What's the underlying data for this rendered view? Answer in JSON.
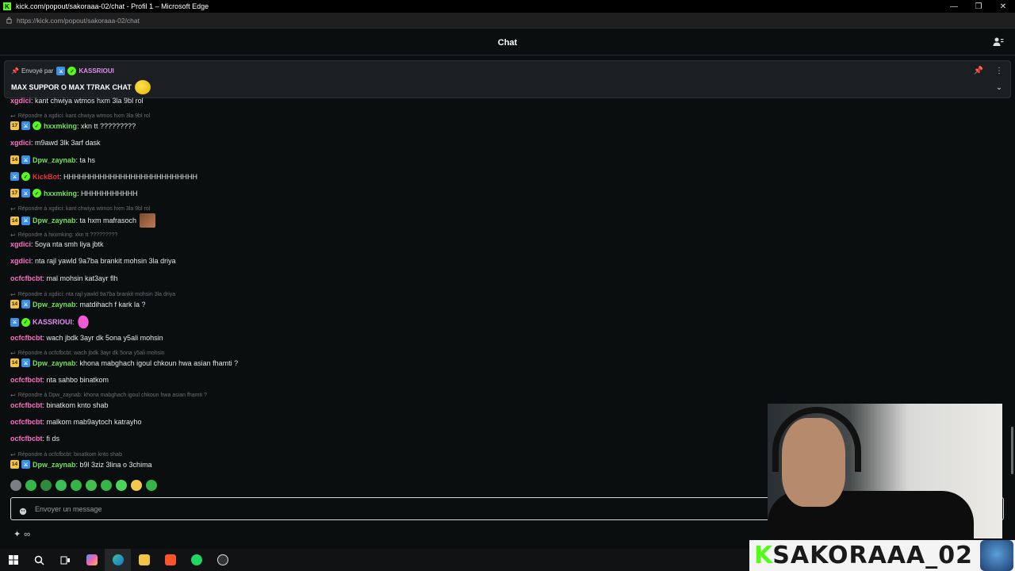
{
  "window": {
    "title": "kick.com/popout/sakoraaa-02/chat - Profil 1 – Microsoft Edge",
    "url": "https://kick.com/popout/sakoraaa-02/chat"
  },
  "header": {
    "title": "Chat"
  },
  "pinned": {
    "sent_by_label": "Envoyé par",
    "author": "KASSRIOUI",
    "message": "MAX SUPPOR O MAX T7RAK CHAT"
  },
  "messages": [
    {
      "user": "xgdici",
      "text": ": kant chwiya wtmos hxm 3la 9bl rol"
    },
    {
      "reply": "Répondre à xgdici: kant chwiya wtmos hxm 3la 9bl rol"
    },
    {
      "badge": "17",
      "user": "hxxmking",
      "text": ": xkn tt ?????????"
    },
    {
      "user": "xgdici",
      "text": ": m9awd 3lk 3arf dask"
    },
    {
      "badge": "14",
      "user": "Dpw_zaynab",
      "text": ": ta hs"
    },
    {
      "user": "KickBot",
      "text": ": HHHHHHHHHHHHHHHHHHHHHHHHHH"
    },
    {
      "badge": "17",
      "user": "hxxmking",
      "text": ": HHHHHHHHHHH"
    },
    {
      "reply": "Répondre à xgdici: kant chwiya wtmos hxm 3la 9bl rol"
    },
    {
      "badge": "14",
      "user": "Dpw_zaynab",
      "text": ": ta hxm mafrasoch"
    },
    {
      "reply": "Répondre à hxxmking: xkn tt ?????????"
    },
    {
      "user": "xgdici",
      "text": ": 5oya nta smh liya jbtk"
    },
    {
      "user": "xgdici",
      "text": ": nta rajl yawld 9a7ba brankit mohsin 3la driya"
    },
    {
      "user": "ocfcfbcbt",
      "text": ": mal mohsin kat3ayr flh"
    },
    {
      "reply": "Répondre à xgdici: nta rajl yawld 9a7ba brankit mohsin 3la driya"
    },
    {
      "badge": "14",
      "user": "Dpw_zaynab",
      "text": ": matdihach f kark la ?"
    },
    {
      "user": "KASSRIOUI",
      "text": ":"
    },
    {
      "user": "ocfcfbcbt",
      "text": ": wach jbdk 3ayr dk 5ona y5ali mohsin"
    },
    {
      "reply": "Répondre à ocfcfbcbt: wach jbdk 3ayr dk 5ona y5ali mohsin"
    },
    {
      "badge": "14",
      "user": "Dpw_zaynab",
      "text": ": khona mabghach igoul chkoun hwa asian fhamti ?"
    },
    {
      "user": "ocfcfbcbt",
      "text": ": nta sahbo binatkom"
    },
    {
      "reply": "Répondre à Dpw_zaynab: khona mabghach igoul chkoun hwa asian fhamti ?"
    },
    {
      "user": "ocfcfbcbt",
      "text": ": binatkom knto shab"
    },
    {
      "user": "ocfcfbcbt",
      "text": ": malkom mab9aytoch katrayho"
    },
    {
      "user": "ocfcfbcbt",
      "text": ": fi ds"
    },
    {
      "reply": "Répondre à ocfcfbcbt: binatkom knto shab"
    },
    {
      "badge": "14",
      "user": "Dpw_zaynab",
      "text": ": b9l 3ziz 3lina o 3chima"
    }
  ],
  "input": {
    "placeholder": "Envoyer un message"
  },
  "bottom": {
    "infinity": "∞"
  },
  "overlay": {
    "k": "K",
    "name": "SAKORAAA_02"
  },
  "colors": {
    "kick_green": "#53fc18",
    "pink_user": "#ff6ec7",
    "green_user": "#70e35a"
  }
}
